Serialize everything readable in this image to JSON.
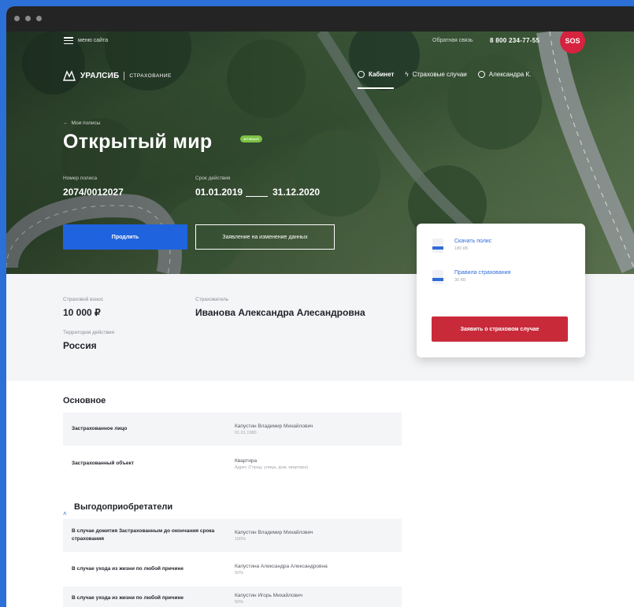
{
  "header": {
    "menu_label": "меню сайта",
    "callback_label": "Обратная связь",
    "phone": "8 800 234-77-55",
    "sos_label": "SOS",
    "logo_name": "УРАЛСИБ",
    "logo_sub": "СТРАХОВАНИЕ",
    "nav": [
      {
        "label": "Кабинет",
        "icon": "shield-icon",
        "active": true
      },
      {
        "label": "Страховые случаи",
        "icon": "lightning-icon"
      },
      {
        "label": "Александра К.",
        "icon": "user-icon"
      }
    ]
  },
  "policy": {
    "breadcrumb": "Мои полисы",
    "title": "Открытый мир",
    "status_badge": "активный",
    "number_label": "Номер полиса",
    "number": "2074/0012027",
    "period_label": "Срок действия",
    "period_start": "01.01.2019",
    "period_end": "31.12.2020",
    "extend_button": "Продлить",
    "change_button": "Заявление на изменение данных"
  },
  "summary": {
    "premium_label": "Страховой взнос",
    "premium_value": "10 000 ₽",
    "holder_label": "Страхователь",
    "holder_value": "Иванова Александра Алесандровна",
    "territory_label": "Территория действия",
    "territory_value": "Россия"
  },
  "documents": [
    {
      "name": "Скачать полис",
      "size": "180 КБ"
    },
    {
      "name": "Правила страхования",
      "size": "30 КБ"
    }
  ],
  "claim_button": "Заявить о страховом случае",
  "main_section": {
    "title": "Основное",
    "rows": [
      {
        "key": "Застрахованное лицо",
        "value": "Капустин Владимир Михайлович",
        "sub": "01.01.1980"
      },
      {
        "key": "Застрахованный объект",
        "value": "Квартира",
        "sub": "Адрес (Город, улица, дом, квартира)"
      }
    ]
  },
  "beneficiaries": {
    "title": "Выгодоприобретатели",
    "rows": [
      {
        "key": "В случае дожития Застрахованным до окончания срока страхования",
        "value": "Капустин Владимир Михайлович",
        "sub": "100%"
      },
      {
        "key": "В случае ухода из жизни по любой причине",
        "value": "Капустина Александра Алексaндровна",
        "sub": "50%"
      },
      {
        "key": "В случае ухода из жизни по любой причине",
        "value": "Капустин Игорь Михайлович",
        "sub": "50%"
      }
    ]
  },
  "colors": {
    "frame": "#2c6fd6",
    "primary": "#1f63df",
    "danger": "#c92a3a",
    "badge": "#7bc143"
  }
}
